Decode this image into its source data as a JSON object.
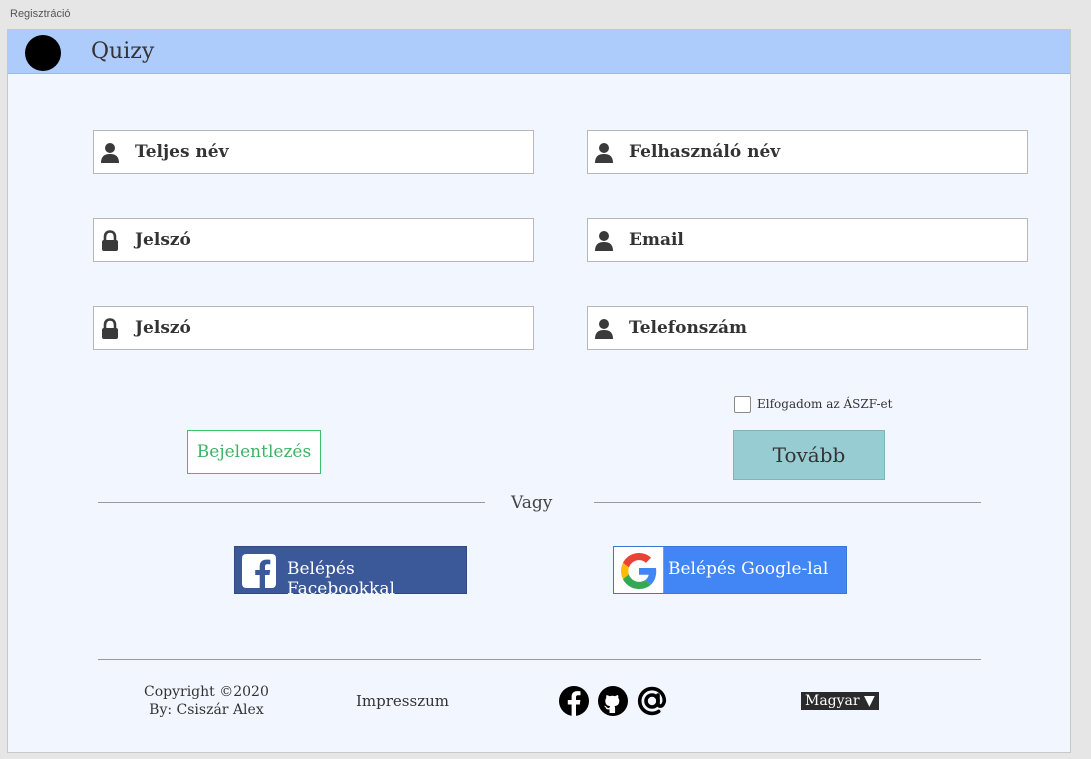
{
  "window": {
    "title": "Regisztráció"
  },
  "header": {
    "brand": "Quizy"
  },
  "form": {
    "fields": [
      {
        "icon": "user-icon",
        "label": "Teljes név"
      },
      {
        "icon": "user-icon",
        "label": "Felhasználó név"
      },
      {
        "icon": "lock-icon",
        "label": "Jelszó"
      },
      {
        "icon": "user-icon",
        "label": "Email"
      },
      {
        "icon": "lock-icon",
        "label": "Jelszó"
      },
      {
        "icon": "user-icon",
        "label": "Telefonszám"
      }
    ],
    "terms_label": "Elfogadom az ÁSZF-et",
    "terms_checked": false,
    "login_button": "Bejelentlezés",
    "next_button": "Tovább"
  },
  "divider": {
    "text": "Vagy"
  },
  "social_login": {
    "facebook": "Belépés Facebookkal",
    "google": "Belépés Google-lal"
  },
  "footer": {
    "copyright": "Copyright ©2020",
    "author": "By: Csiszár Alex",
    "impressum": "Impresszum",
    "social_icons": [
      "facebook-icon",
      "github-icon",
      "at-sign-icon"
    ],
    "language": "Magyar ▼"
  },
  "colors": {
    "header_bg": "#aeccfb",
    "page_bg": "#f2f7ff",
    "login_green": "#3cb365",
    "next_bg": "#97ccd3",
    "facebook_blue": "#3b5998",
    "google_blue": "#4285f4"
  }
}
